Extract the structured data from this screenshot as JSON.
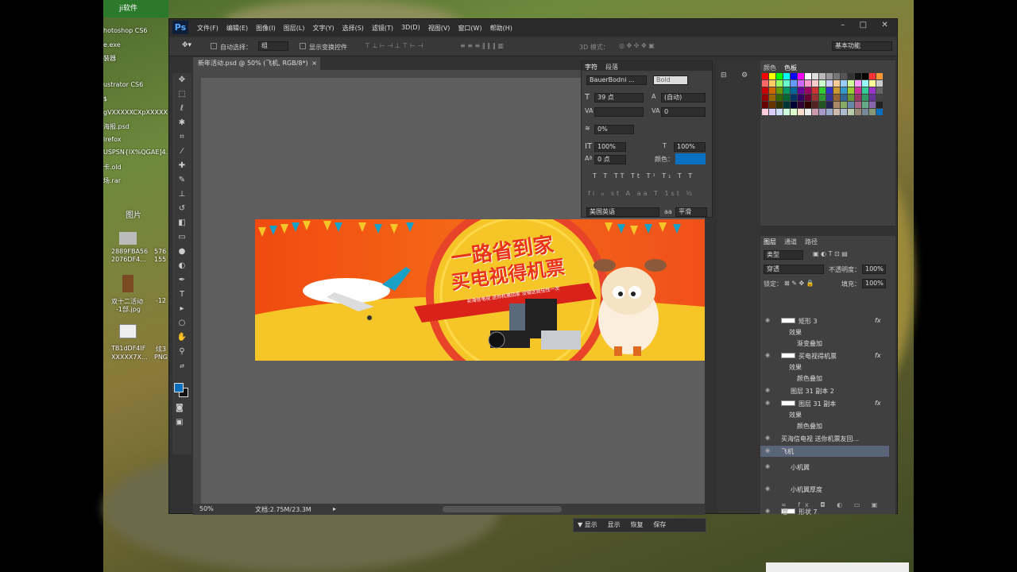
{
  "desktop": {
    "items": [
      "hotoshop CS6",
      "e.exe",
      "装器",
      "ustrator CS6",
      "$",
      "gVXXXXXCXpXXXXX",
      "海报.psd",
      "irefox",
      "USPSN{IX%QGAE]4.I",
      "卡.old",
      "场.rar",
      "图片",
      "2889FBA56",
      "2076DF4...",
      "576",
      "155",
      "双十二活动",
      "-1部.jpg",
      "-12",
      "TB1dDF4IF",
      "XXXXX7X...",
      "炫3",
      "PNG"
    ],
    "top_tab": "ji软件"
  },
  "ps": {
    "logo": "Ps",
    "menu": [
      "文件(F)",
      "编辑(E)",
      "图像(I)",
      "图层(L)",
      "文字(Y)",
      "选择(S)",
      "滤镜(T)",
      "3D(D)",
      "视图(V)",
      "窗口(W)",
      "帮助(H)"
    ],
    "options": {
      "auto_select": "自动选择：",
      "group": "组",
      "show_transform": "显示变换控件",
      "mode3d": "3D 模式：",
      "workspace": "基本功能"
    },
    "doc_tab": "新年活动.psd @ 50% (飞机, RGB/8*)",
    "status": {
      "zoom": "50%",
      "doc": "文档:2.75M/23.3M"
    },
    "banner": {
      "line1": "一路省到家",
      "line2": "买电视得机票",
      "ribbon": "买海信电视 送你机票回家 没错这就任性一次"
    },
    "char_panel": {
      "tabs": [
        "字符",
        "段落"
      ],
      "font": "BauerBodni ...",
      "style": "Bold",
      "size": "39 点",
      "leading": "(自动)",
      "kern": "",
      "track": "0",
      "scale_pct": "0%",
      "vscale": "100%",
      "hscale": "100%",
      "baseline": "0 点",
      "color_label": "颜色：",
      "lang": "美国英语",
      "aa": "平滑",
      "aa_label": "aa"
    },
    "swatches_tabs": [
      "颜色",
      "色板"
    ],
    "layers": {
      "tabs": [
        "图层",
        "通道",
        "路径"
      ],
      "kind": "类型",
      "blend": "穿透",
      "opacity_label": "不透明度：",
      "opacity": "100%",
      "lock_label": "锁定：",
      "fill_label": "填充：",
      "fill": "100%",
      "items": [
        {
          "name": "矩形 3",
          "type": "shape",
          "fx": true
        },
        {
          "name": "效果",
          "type": "sub"
        },
        {
          "name": "渐变叠加",
          "type": "sub2"
        },
        {
          "name": "买电视得机票",
          "type": "shape",
          "fx": true
        },
        {
          "name": "效果",
          "type": "sub"
        },
        {
          "name": "颜色叠加",
          "type": "sub2"
        },
        {
          "name": "图层 31 副本 2",
          "type": "smart"
        },
        {
          "name": "图层 31 副本",
          "type": "shape",
          "fx": true
        },
        {
          "name": "效果",
          "type": "sub"
        },
        {
          "name": "颜色叠加",
          "type": "sub2"
        },
        {
          "name": "买海信电视 送你机票友回...",
          "type": "text"
        },
        {
          "name": "飞机",
          "type": "group"
        },
        {
          "name": "小机翼",
          "type": "smart"
        },
        {
          "name": "小机翼厚度",
          "type": "smart"
        },
        {
          "name": "形状 7",
          "type": "shape"
        }
      ]
    },
    "bottom_buttons": [
      "▼ 显示",
      "显示",
      "恢复",
      "保存"
    ]
  },
  "colors": {
    "accent": "#0a6fbf",
    "banner_orange": "#f04a10",
    "banner_yellow": "#f6c629"
  }
}
